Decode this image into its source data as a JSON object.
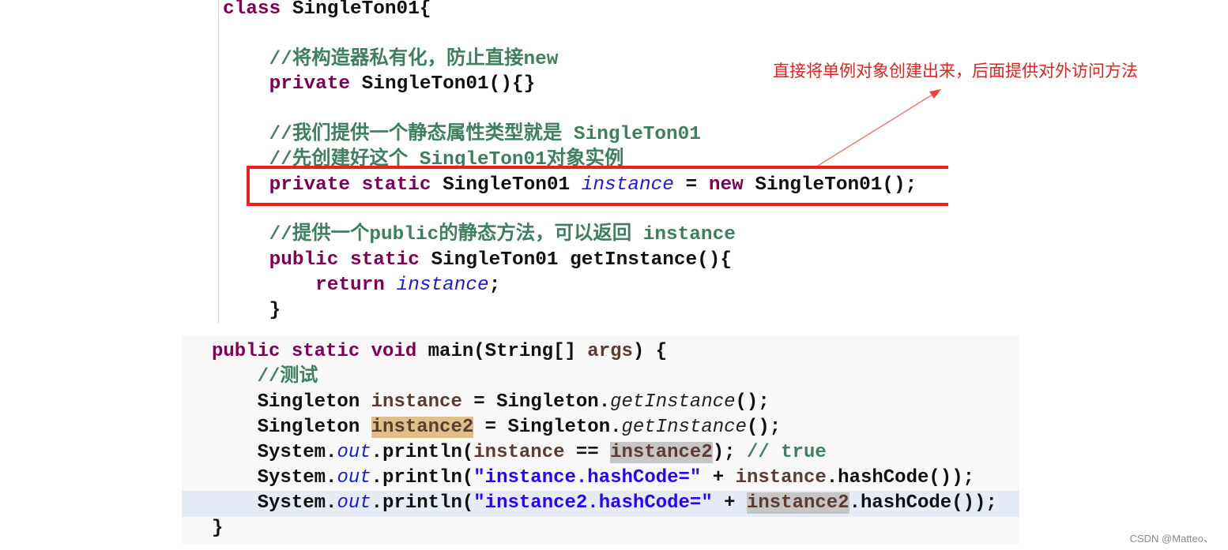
{
  "top_code": {
    "lines": [
      [
        {
          "t": "class ",
          "c": "kw"
        },
        {
          "t": "SingleTon01{",
          "c": ""
        }
      ],
      [],
      [
        {
          "t": "    //将构造器私有化，防止直接new",
          "c": "cm"
        }
      ],
      [
        {
          "t": "    ",
          "c": ""
        },
        {
          "t": "private ",
          "c": "kw"
        },
        {
          "t": "SingleTon01(){}",
          "c": ""
        }
      ],
      [],
      [
        {
          "t": "    //我们提供一个静态属性类型就是 SingleTon01",
          "c": "cm"
        }
      ],
      [
        {
          "t": "    //先创建好这个 SingleTon01对象实例",
          "c": "cm"
        }
      ],
      [
        {
          "t": "    ",
          "c": ""
        },
        {
          "t": "private static ",
          "c": "kw"
        },
        {
          "t": "SingleTon01 ",
          "c": ""
        },
        {
          "t": "instance",
          "c": "fd"
        },
        {
          "t": " = ",
          "c": ""
        },
        {
          "t": "new ",
          "c": "kw"
        },
        {
          "t": "SingleTon01();",
          "c": ""
        }
      ],
      [],
      [
        {
          "t": "    //提供一个public的静态方法，可以返回 instance",
          "c": "cm"
        }
      ],
      [
        {
          "t": "    ",
          "c": ""
        },
        {
          "t": "public static ",
          "c": "kw"
        },
        {
          "t": "SingleTon01 getInstance(){",
          "c": ""
        }
      ],
      [
        {
          "t": "        ",
          "c": ""
        },
        {
          "t": "return ",
          "c": "kw"
        },
        {
          "t": "instance",
          "c": "fd"
        },
        {
          "t": ";",
          "c": ""
        }
      ],
      [
        {
          "t": "    }",
          "c": ""
        }
      ]
    ]
  },
  "bottom_code": {
    "lines": [
      [
        {
          "t": "public static void ",
          "c": "kw"
        },
        {
          "t": "main(String[] ",
          "c": ""
        },
        {
          "t": "args",
          "c": "lv"
        },
        {
          "t": ") {",
          "c": ""
        }
      ],
      [
        {
          "t": "    //测试",
          "c": "cm"
        }
      ],
      [
        {
          "t": "    Singleton ",
          "c": ""
        },
        {
          "t": "instance",
          "c": "lv"
        },
        {
          "t": " = Singleton.",
          "c": ""
        },
        {
          "t": "getInstance",
          "c": "mi"
        },
        {
          "t": "();",
          "c": ""
        }
      ],
      [
        {
          "t": "    Singleton ",
          "c": ""
        },
        {
          "t": "instance2",
          "c": "hl-orange"
        },
        {
          "t": " = Singleton.",
          "c": ""
        },
        {
          "t": "getInstance",
          "c": "mi"
        },
        {
          "t": "();",
          "c": ""
        }
      ],
      [
        {
          "t": "    System.",
          "c": ""
        },
        {
          "t": "out",
          "c": "fd"
        },
        {
          "t": ".println(",
          "c": ""
        },
        {
          "t": "instance",
          "c": "lv"
        },
        {
          "t": " == ",
          "c": ""
        },
        {
          "t": "instance2",
          "c": "hl-gray"
        },
        {
          "t": "); ",
          "c": ""
        },
        {
          "t": "// true",
          "c": "cm"
        }
      ],
      [
        {
          "t": "    System.",
          "c": ""
        },
        {
          "t": "out",
          "c": "fd"
        },
        {
          "t": ".println(",
          "c": ""
        },
        {
          "t": "\"instance.hashCode=\"",
          "c": "st"
        },
        {
          "t": " + ",
          "c": ""
        },
        {
          "t": "instance",
          "c": "lv"
        },
        {
          "t": ".hashCode());",
          "c": ""
        }
      ],
      [
        {
          "t": "    System.",
          "c": ""
        },
        {
          "t": "out",
          "c": "fd"
        },
        {
          "t": ".println(",
          "c": ""
        },
        {
          "t": "\"instance2.hashCode=\"",
          "c": "st"
        },
        {
          "t": " + ",
          "c": ""
        },
        {
          "t": "instance2",
          "c": "hl-gray"
        },
        {
          "t": ".hashCode());",
          "c": ""
        }
      ],
      [
        {
          "t": "}",
          "c": ""
        }
      ]
    ]
  },
  "annotation": {
    "text": "直接将单例对象创建出来，后面提供对外访问方法",
    "color": "#e8201f"
  },
  "watermark": "CSDN @Matteo、",
  "colors": {
    "keyword": "#7f0055",
    "comment": "#3f7f5f",
    "field": "#1a1ae0",
    "string": "#2a00ff",
    "highlight_box": "#f21d1d"
  }
}
